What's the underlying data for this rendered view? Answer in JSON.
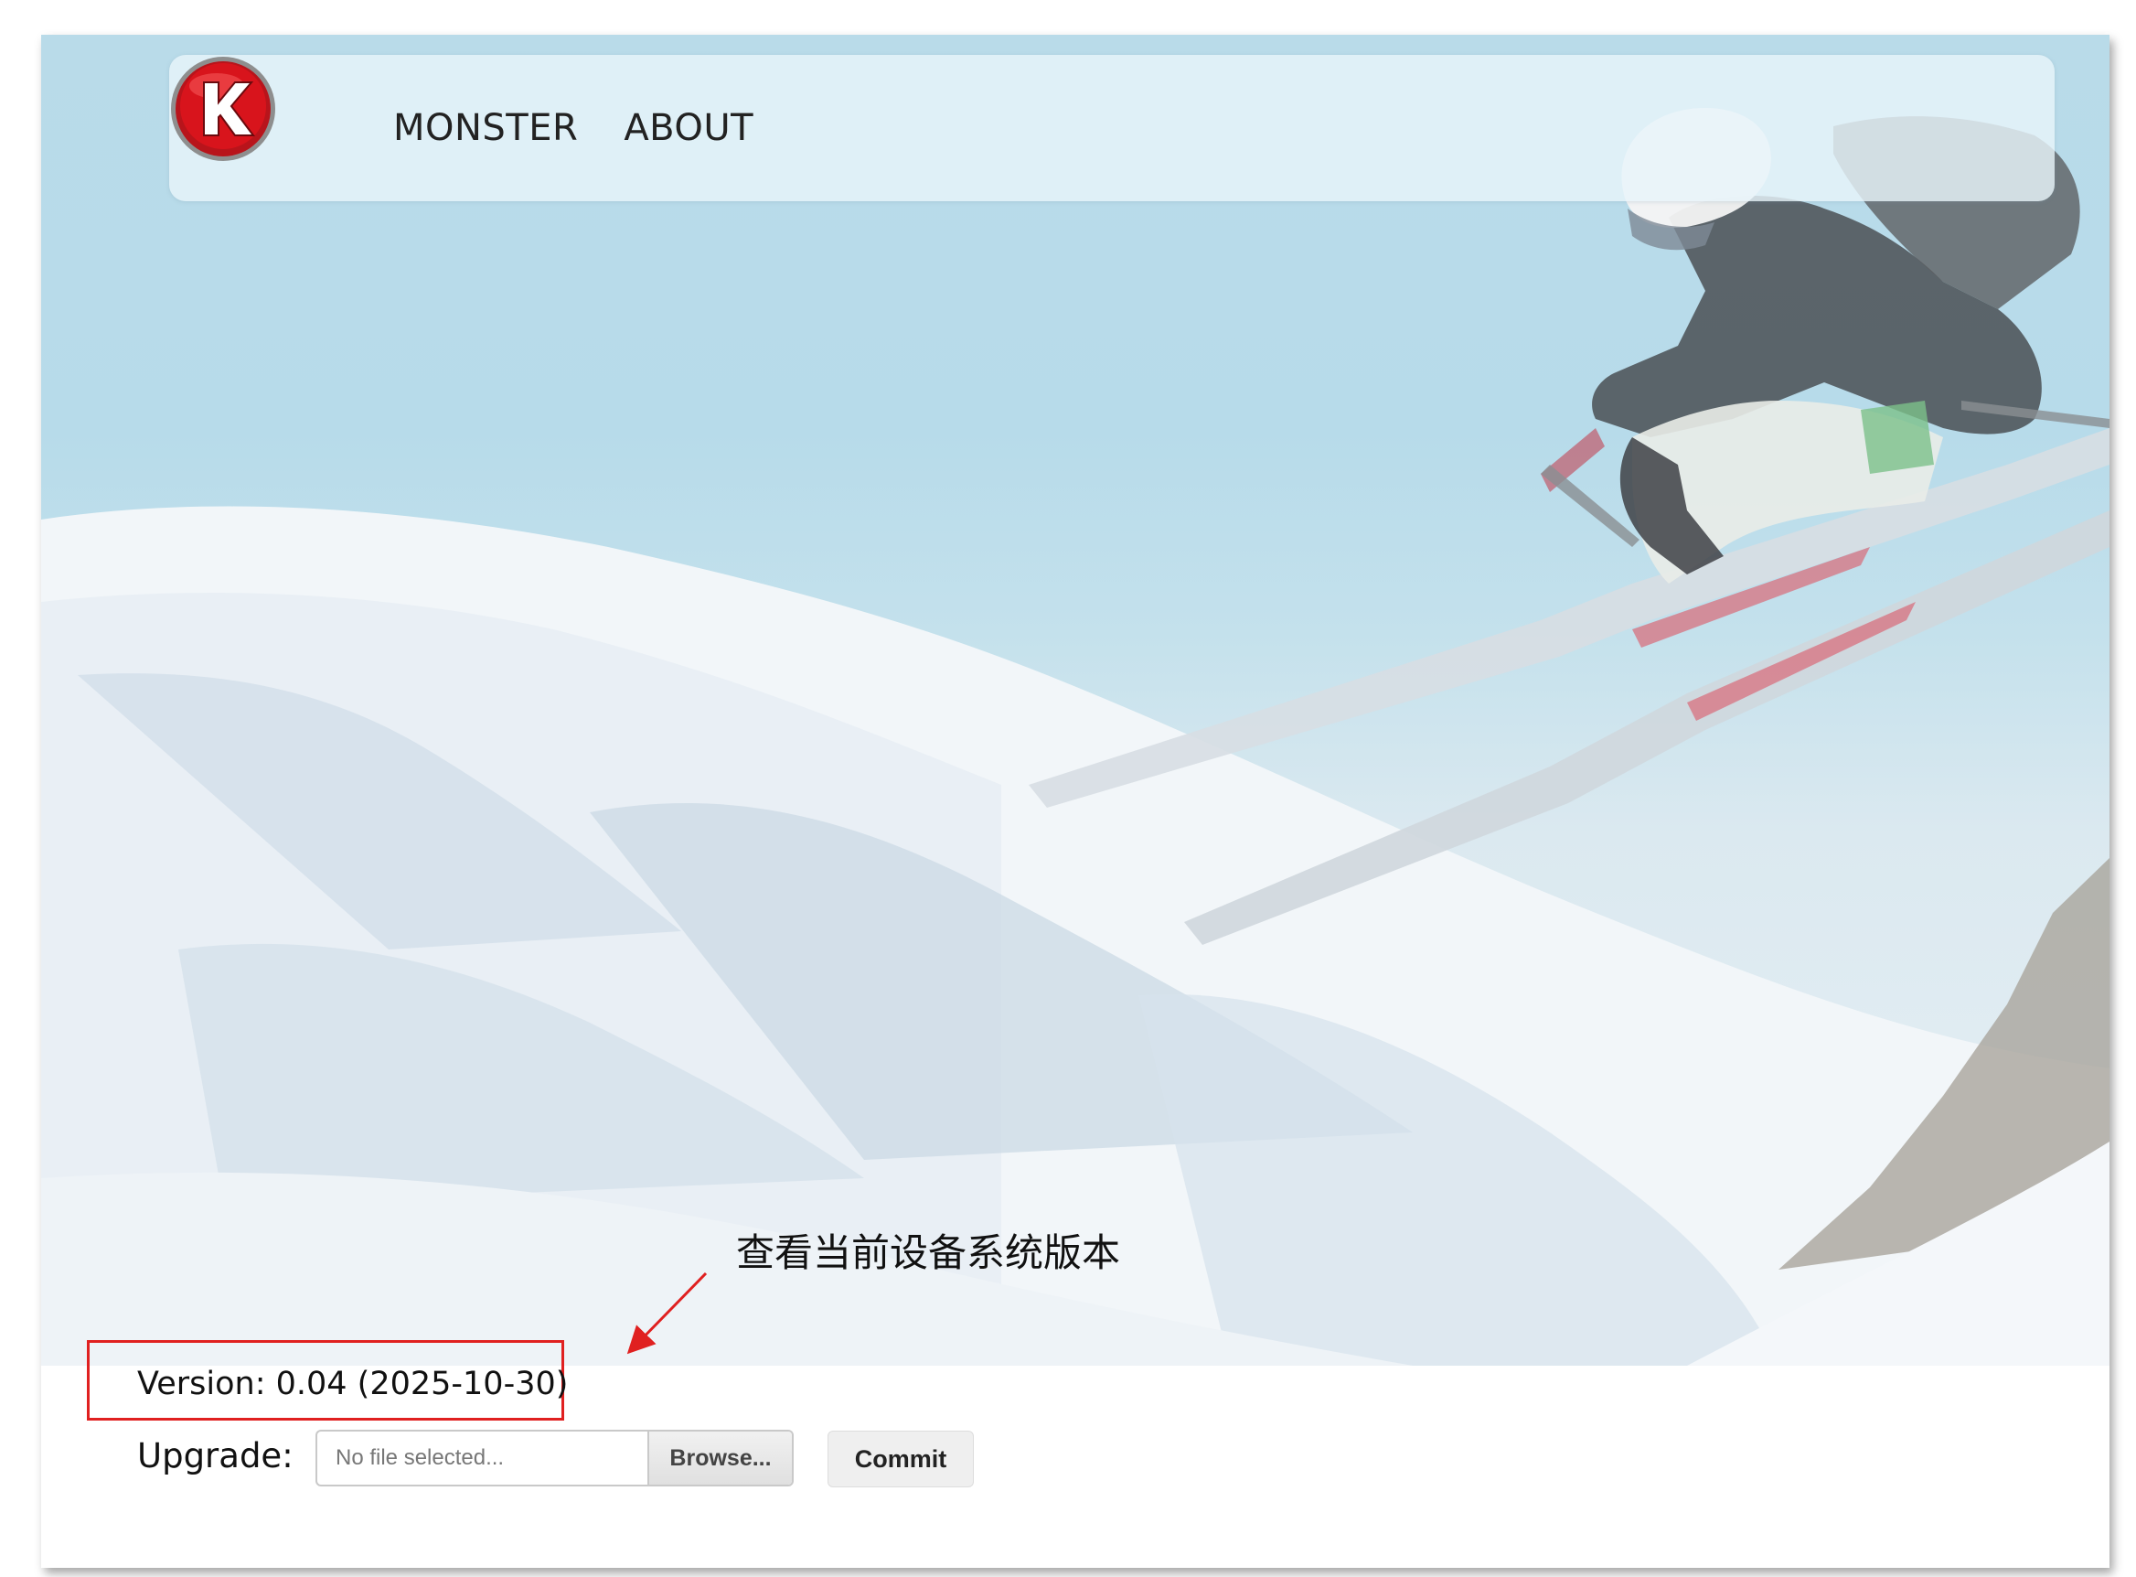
{
  "nav": {
    "logo_letter": "K",
    "items": [
      {
        "label": "MONSTER"
      },
      {
        "label": "ABOUT"
      }
    ]
  },
  "annotation": {
    "text": "查看当前设备系统版本",
    "color": "#e02020"
  },
  "firmware": {
    "version_text": "Version: 0.04 (2025-10-30)",
    "upgrade_label": "Upgrade:",
    "file_placeholder": "No file selected...",
    "browse_label": "Browse...",
    "commit_label": "Commit"
  },
  "colors": {
    "logo_red": "#d8141c",
    "highlight_border": "#e02020",
    "sky": "#b9dbe9"
  },
  "icons": {
    "logo": "brand-k-logo-icon",
    "hero": "skier-background-image"
  }
}
